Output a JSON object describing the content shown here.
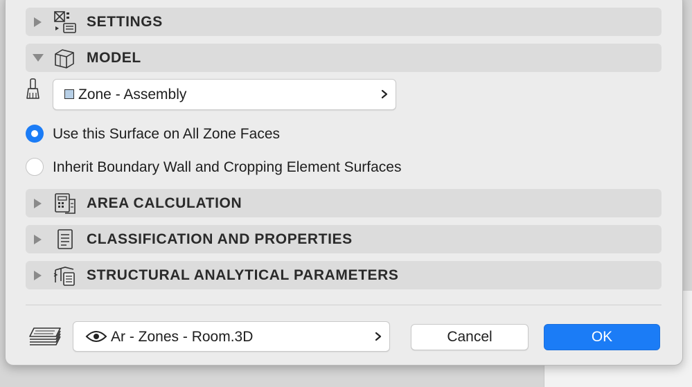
{
  "sections": {
    "settings": {
      "title": "SETTINGS",
      "icon": "settings-icon",
      "expanded": false
    },
    "model": {
      "title": "MODEL",
      "icon": "model-icon",
      "expanded": true
    },
    "area_calculation": {
      "title": "AREA CALCULATION",
      "icon": "area-calculation-icon",
      "expanded": false
    },
    "classification": {
      "title": "CLASSIFICATION AND PROPERTIES",
      "icon": "classification-icon",
      "expanded": false
    },
    "structural": {
      "title": "STRUCTURAL ANALYTICAL PARAMETERS",
      "icon": "structural-icon",
      "expanded": false
    }
  },
  "model": {
    "surface_select": {
      "value": "Zone - Assembly",
      "swatch_color": "#b7cfe6"
    },
    "radio_options": [
      {
        "label": "Use this Surface on All Zone Faces",
        "selected": true
      },
      {
        "label": "Inherit Boundary Wall and Cropping Element Surfaces",
        "selected": false
      }
    ]
  },
  "footer": {
    "layer_select": {
      "value": "Ar - Zones - Room.3D"
    },
    "cancel_label": "Cancel",
    "ok_label": "OK"
  },
  "colors": {
    "accent": "#1b7cf6",
    "section_bg": "#dcdcdc",
    "dialog_bg": "#ececec"
  }
}
